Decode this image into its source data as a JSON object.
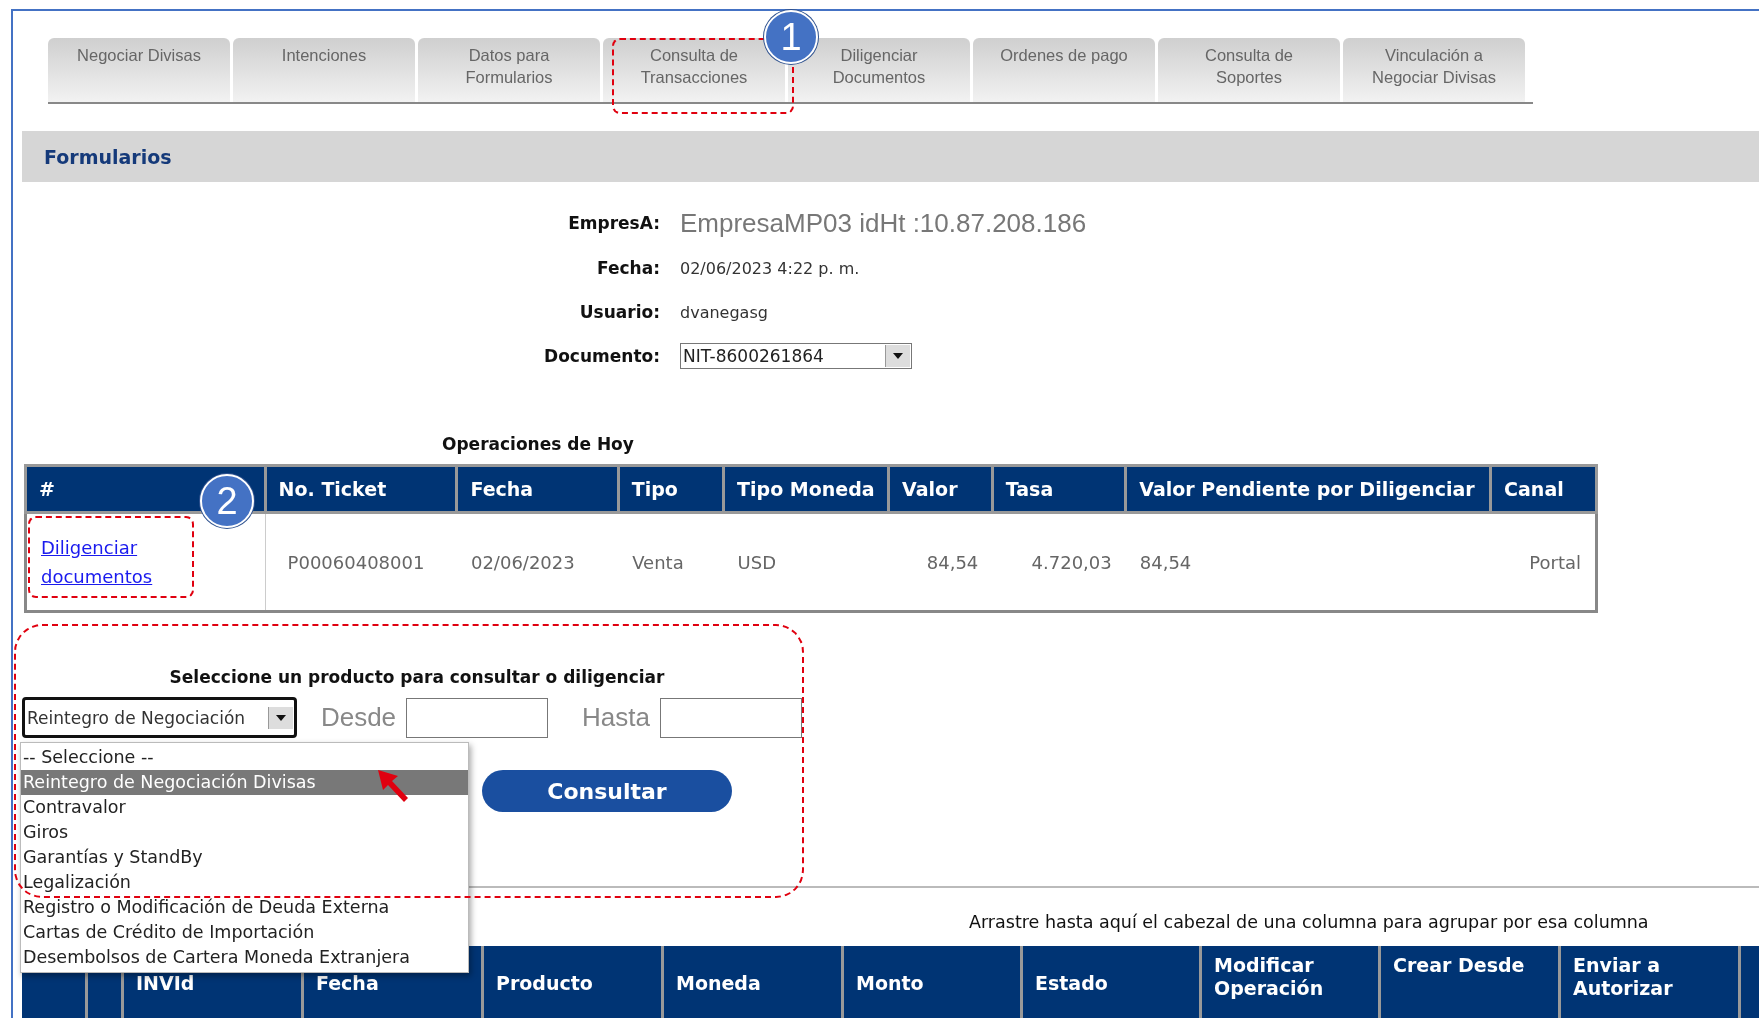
{
  "tabs": [
    {
      "label": "Negociar Divisas"
    },
    {
      "label": "Intenciones"
    },
    {
      "label": "Datos para Formularios"
    },
    {
      "label": "Consulta de Transacciones"
    },
    {
      "label": "Diligenciar Documentos"
    },
    {
      "label": "Ordenes de pago"
    },
    {
      "label": "Consulta de Soportes"
    },
    {
      "label": "Vinculación a Negociar Divisas"
    }
  ],
  "section_title": "Formularios",
  "info": [
    {
      "label": "EmpresA:",
      "value": "EmpresaMP03 idHt :10.87.208.186",
      "kind": "large"
    },
    {
      "label": "Fecha:",
      "value": "02/06/2023 4:22 p. m.",
      "kind": "text"
    },
    {
      "label": "Usuario:",
      "value": "dvanegasg",
      "kind": "text"
    },
    {
      "label": "Documento:",
      "value": "NIT-8600261864",
      "kind": "select"
    }
  ],
  "operations": {
    "title": "Operaciones de Hoy",
    "columns": [
      "#",
      "No. Ticket",
      "Fecha",
      "Tipo",
      "Tipo Moneda",
      "Valor",
      "Tasa",
      "Valor Pendiente por Diligenciar",
      "Canal"
    ],
    "rows": [
      {
        "cells": [
          "Diligenciar documentos",
          "P00060408001",
          "02/06/2023",
          "Venta",
          "USD",
          "84,54",
          "4.720,03",
          "84,54",
          "Portal"
        ]
      }
    ]
  },
  "product_search": {
    "title": "Seleccione un producto para consultar o diligenciar",
    "select_value": "Reintegro de Negociación",
    "desde_label": "Desde",
    "hasta_label": "Hasta",
    "button": "Consultar",
    "options": [
      {
        "label": "-- Seleccione --",
        "selected": false
      },
      {
        "label": "Reintegro de Negociación Divisas",
        "selected": true
      },
      {
        "label": "Contravalor",
        "selected": false
      },
      {
        "label": "Giros",
        "selected": false
      },
      {
        "label": "Garantías y StandBy",
        "selected": false
      },
      {
        "label": "Legalización",
        "selected": false
      },
      {
        "label": "Registro o Modificación de Deuda Externa",
        "selected": false
      },
      {
        "label": "Cartas de Crédito de Importación",
        "selected": false
      },
      {
        "label": "Desembolsos de Cartera Moneda Extranjera",
        "selected": false
      }
    ]
  },
  "grid": {
    "hint": "Arrastre hasta aquí el cabezal de una columna para agrupar por esa columna",
    "columns": [
      "INVId",
      "Fecha",
      "Producto",
      "Moneda",
      "Monto",
      "Estado",
      "Modificar Operación",
      "Crear Desde",
      "Enviar a Autorizar"
    ]
  },
  "annotations": [
    {
      "label": "1"
    },
    {
      "label": "2"
    }
  ]
}
